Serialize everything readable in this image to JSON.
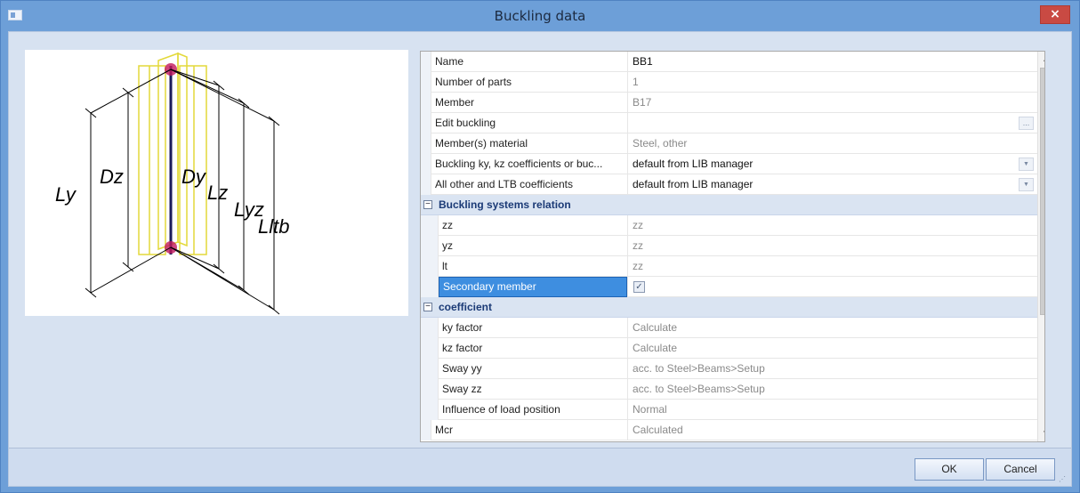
{
  "window": {
    "title": "Buckling data",
    "close_label": "×"
  },
  "preview": {
    "labels": {
      "ly": "Ly",
      "dz": "Dz",
      "dy": "Dy",
      "lz": "Lz",
      "lyz": "Lyz",
      "lltb": "Lltb"
    }
  },
  "properties": {
    "rows": [
      {
        "label": "Name",
        "value": "BB1"
      },
      {
        "label": "Number of parts",
        "value": "1"
      },
      {
        "label": "Member",
        "value": "B17"
      },
      {
        "label": "Edit buckling",
        "value": ""
      },
      {
        "label": "Member(s) material",
        "value": "Steel, other"
      },
      {
        "label": "Buckling ky, kz coefficients or buc...",
        "value": "default from LIB manager"
      },
      {
        "label": "All other and LTB coefficients",
        "value": "default from LIB manager"
      }
    ],
    "section1": {
      "label": "Buckling systems relation",
      "rows": [
        {
          "label": "zz",
          "value": "zz"
        },
        {
          "label": "yz",
          "value": "zz"
        },
        {
          "label": "lt",
          "value": "zz"
        },
        {
          "label": "Secondary member",
          "checked": true
        }
      ]
    },
    "section2": {
      "label": "coefficient",
      "rows": [
        {
          "label": "ky factor",
          "value": "Calculate"
        },
        {
          "label": "kz factor",
          "value": "Calculate"
        },
        {
          "label": "Sway yy",
          "value": "acc. to Steel>Beams>Setup"
        },
        {
          "label": "Sway zz",
          "value": "acc. to Steel>Beams>Setup"
        },
        {
          "label": "Influence of load position",
          "value": "Normal"
        }
      ]
    },
    "mcr_row": {
      "label": "Mcr",
      "value": "Calculated"
    },
    "ellipsis": "...",
    "collapse_glyph": "−",
    "check_glyph": "✓"
  },
  "buttons": {
    "ok": "OK",
    "cancel": "Cancel"
  },
  "colors": {
    "titlebar": "#6d9fd8",
    "close": "#c94a43",
    "selection": "#3e8ee0",
    "section_text": "#1b3a76"
  }
}
